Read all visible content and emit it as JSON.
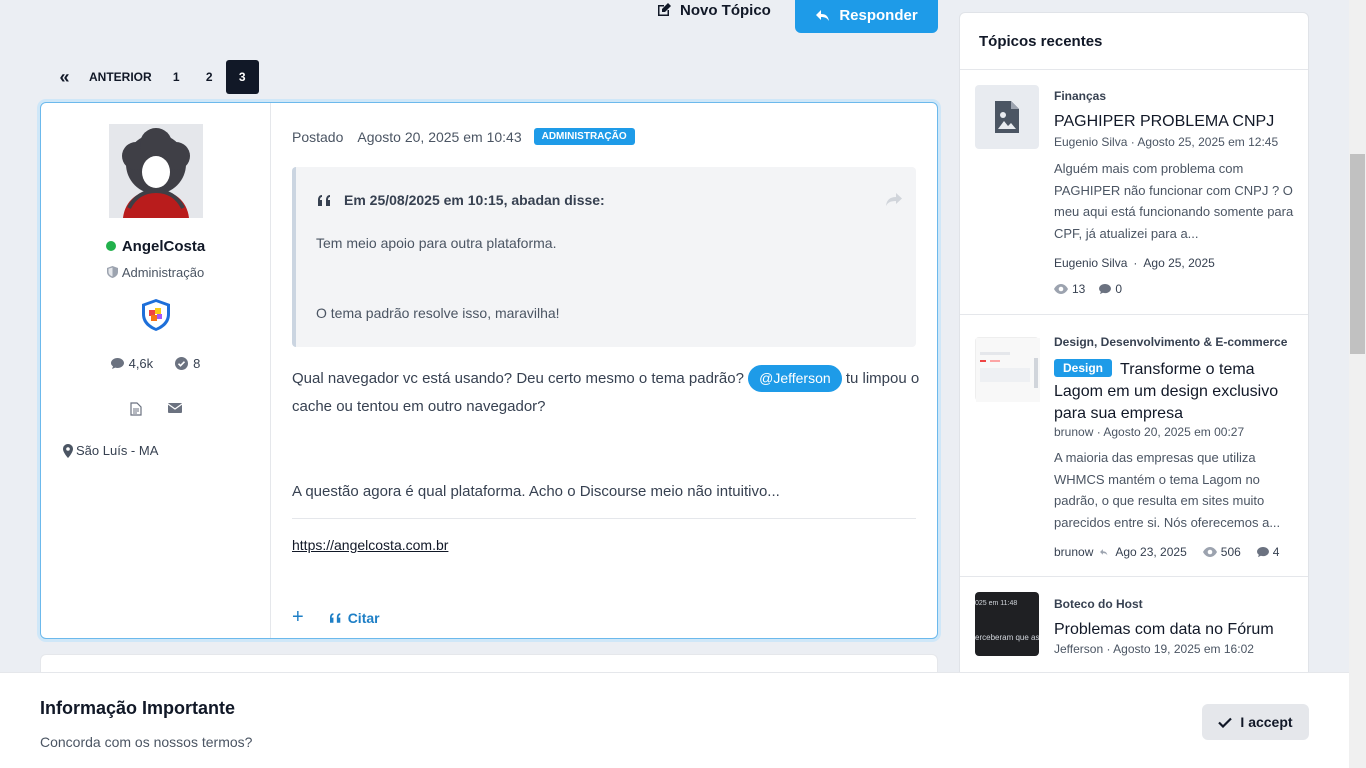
{
  "header": {
    "new_topic_label": "Novo Tópico",
    "reply_label": "Responder"
  },
  "pagination": {
    "first_symbol": "«",
    "prev_label": "ANTERIOR",
    "pages": [
      "1",
      "2",
      "3"
    ],
    "current": "3"
  },
  "post": {
    "author": {
      "name": "AngelCosta",
      "role": "Administração",
      "posts_count": "4,6k",
      "solutions_count": "8",
      "location": "São Luís - MA"
    },
    "posted_label": "Postado",
    "date": "Agosto 20, 2025 em 10:43",
    "group_badge": "ADMINISTRAÇÃO",
    "quote": {
      "header": "Em 25/08/2025 em 10:15, abadan disse:",
      "line1": "Tem meio apoio para outra plataforma.",
      "line2": "O tema padrão resolve isso, maravilha!"
    },
    "body_before_mention": "Qual navegador vc está usando? Deu certo mesmo o tema padrão? ",
    "mention": "@Jefferson",
    "body_after_mention": " tu limpou o cache ou tentou em outro navegador?",
    "body2": "A questão agora é qual plataforma. Acho o Discourse meio não intuitivo...",
    "signature_link": "https://angelcosta.com.br",
    "actions": {
      "plus": "+",
      "quote_label": "Citar"
    }
  },
  "sidebar": {
    "title": "Tópicos recentes",
    "topics": [
      {
        "category": "Finanças",
        "title": "PAGHIPER PROBLEMA CNPJ",
        "byline": "Eugenio Silva · Agosto 25, 2025 em 12:45",
        "excerpt": "Alguém mais com problema com PAGHIPER não funcionar com CNPJ ? O meu aqui está funcionando somente para CPF, já atualizei para a...",
        "last_user": "Eugenio Silva",
        "last_date": "Ago 25, 2025",
        "views": "13",
        "replies": "0"
      },
      {
        "category": "Design, Desenvolvimento & E-commerce",
        "tag": "Design",
        "title": "Transforme o tema Lagom em um design exclusivo para sua empresa",
        "byline": "brunow · Agosto 20, 2025 em 00:27",
        "excerpt": "A maioria das empresas que utiliza WHMCS mantém o tema Lagom no padrão, o que resulta em sites muito parecidos entre si. Nós oferecemos a...",
        "last_user": "brunow",
        "last_date": "Ago 23, 2025",
        "views": "506",
        "replies": "4"
      },
      {
        "category": "Boteco do Host",
        "title": "Problemas com data no Fórum",
        "byline": "Jefferson · Agosto 19, 2025 em 16:02",
        "thumb_text_top": "025 em 11:48",
        "thumb_text_bottom": "erceberam que as"
      }
    ]
  },
  "cookie": {
    "title": "Informação Importante",
    "subtitle": "Concorda com os nossos termos?",
    "accept_label": "I accept"
  },
  "colors": {
    "accent": "#1e9be8",
    "dark": "#111827",
    "online": "#22b14c"
  }
}
